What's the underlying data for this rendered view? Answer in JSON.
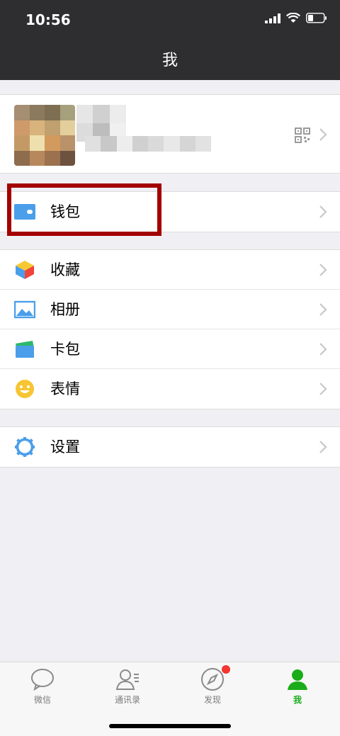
{
  "status_bar": {
    "time": "10:56"
  },
  "nav": {
    "title": "我"
  },
  "wallet_section": {
    "items": [
      {
        "label": "钱包",
        "icon": "wallet-icon"
      }
    ]
  },
  "features_section": {
    "items": [
      {
        "label": "收藏",
        "icon": "favorites-icon"
      },
      {
        "label": "相册",
        "icon": "album-icon"
      },
      {
        "label": "卡包",
        "icon": "card-package-icon"
      },
      {
        "label": "表情",
        "icon": "sticker-icon"
      }
    ]
  },
  "settings_section": {
    "items": [
      {
        "label": "设置",
        "icon": "settings-icon"
      }
    ]
  },
  "tabbar": {
    "tabs": [
      {
        "label": "微信",
        "active": false
      },
      {
        "label": "通讯录",
        "active": false
      },
      {
        "label": "发现",
        "active": false
      },
      {
        "label": "我",
        "active": true
      }
    ]
  },
  "colors": {
    "header": "#2e2e30",
    "background": "#efeff4",
    "accent": "#1aad19",
    "highlight": "#a30000"
  }
}
